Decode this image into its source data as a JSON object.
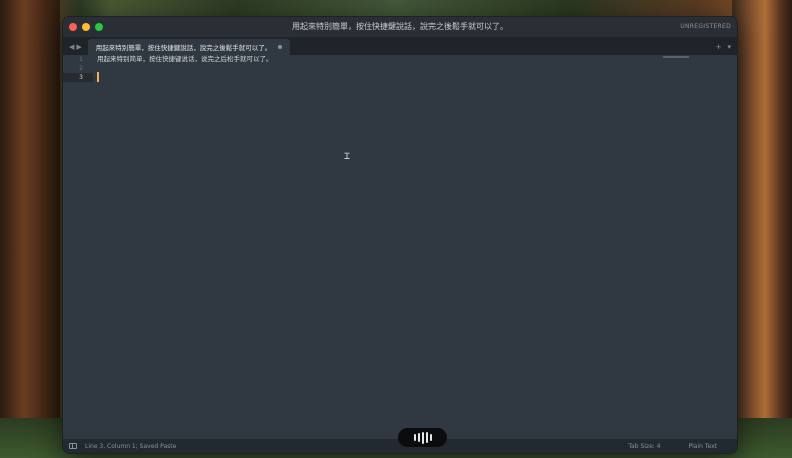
{
  "window": {
    "title": "用起來特別簡單，按住快捷鍵說話，說完之後鬆手就可以了。",
    "unregistered": "UNREGISTERED"
  },
  "tabs": [
    {
      "label": "用起來特別簡單，按住快捷鍵說話，說完之後鬆手就可以了。",
      "dirty": true
    }
  ],
  "editor": {
    "line_numbers": [
      "1",
      "2",
      "3"
    ],
    "lines": [
      "用起来特别简单，按住快捷键说话，说完之后松手就可以了。",
      "",
      ""
    ],
    "current_line": 3
  },
  "status": {
    "position": "Line 3, Column 1; Saved Paste",
    "tab_size": "Tab Size: 4",
    "syntax": "Plain Text"
  },
  "voice_indicator": {
    "levels": [
      0.4,
      0.7,
      1.0,
      0.8,
      0.5
    ]
  }
}
